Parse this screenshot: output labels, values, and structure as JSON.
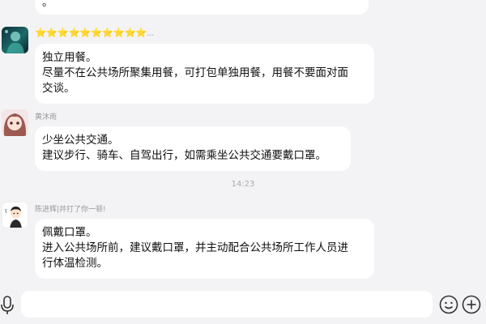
{
  "messages": [
    {
      "lines": [
        "。"
      ]
    },
    {
      "sender_badge": "⭐⭐⭐⭐⭐⭐⭐⭐⭐⭐",
      "badge_overflow": "…",
      "lines": [
        "独立用餐。",
        "尽量不在公共场所聚集用餐，可打包单独用餐，用餐不要面对面",
        "交谈。"
      ]
    },
    {
      "sender": "黄沐雨",
      "lines": [
        "少坐公共交通。",
        "建议步行、骑车、自驾出行，如需乘坐公共交通要戴口罩。"
      ]
    },
    {
      "sender": "陈进辉|并打了你一顿!",
      "lines": [
        "佩戴口罩。",
        "进入公共场所前，建议戴口罩，并主动配合公共场所工作人员进",
        "行体温检测。"
      ]
    }
  ],
  "timestamp": "14:23",
  "input": {
    "placeholder": ""
  },
  "icons": {
    "voice": "microphone-icon",
    "emoji": "emoji-icon",
    "more": "plus-icon"
  }
}
